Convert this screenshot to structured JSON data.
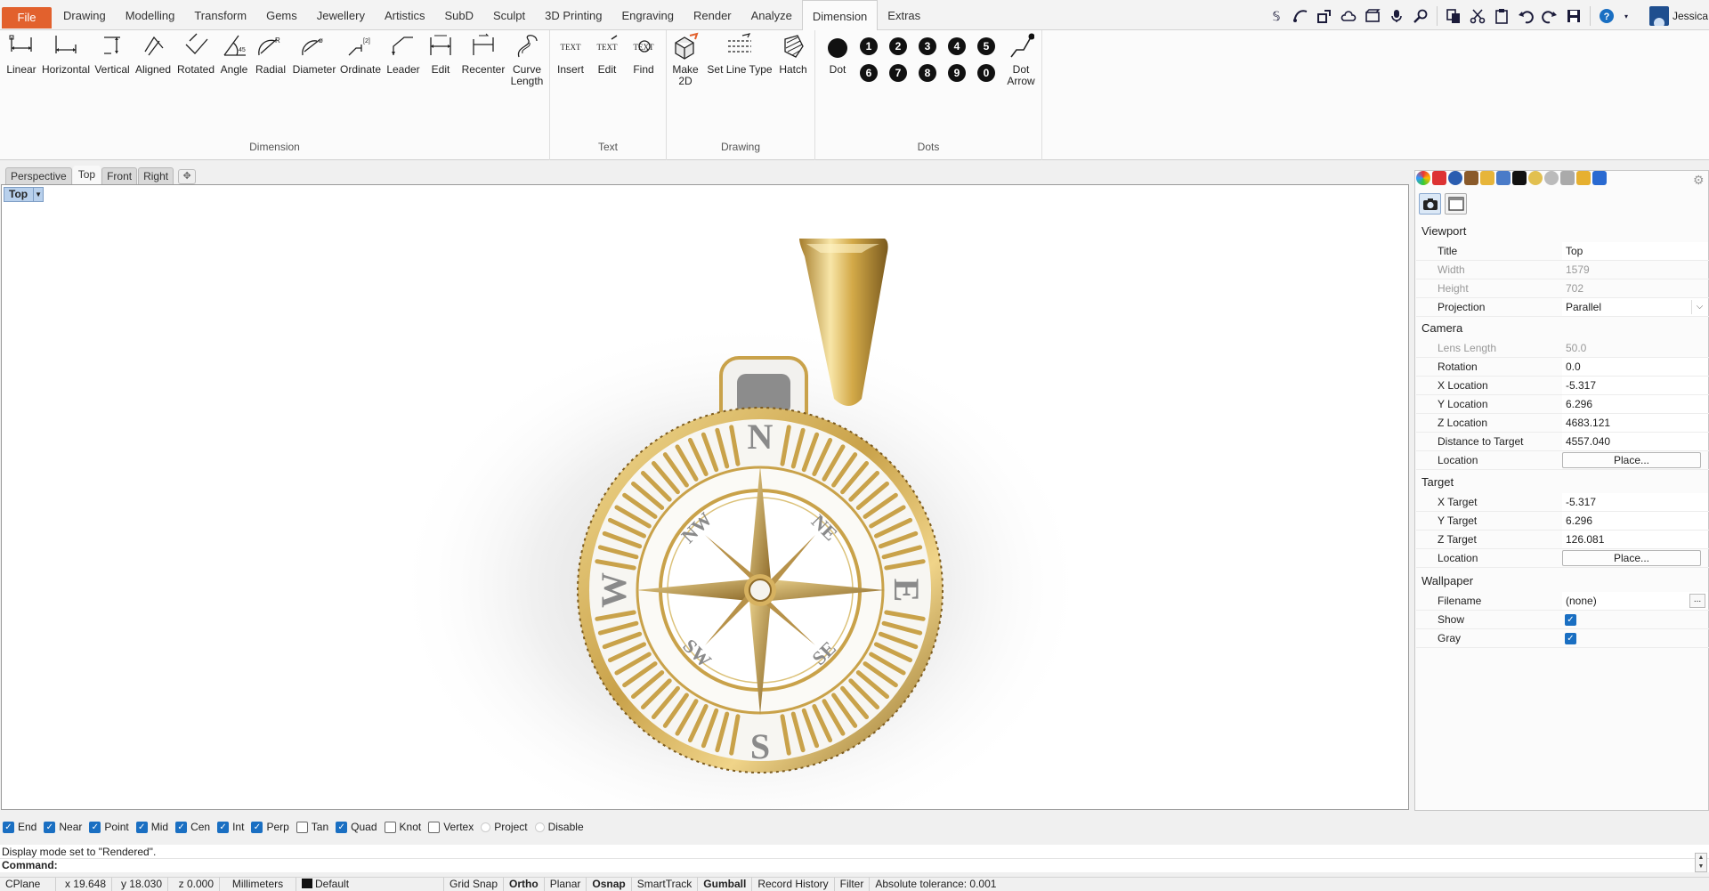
{
  "menubar": {
    "file_label": "File",
    "tabs": [
      "Drawing",
      "Modelling",
      "Transform",
      "Gems",
      "Jewellery",
      "Artistics",
      "SubD",
      "Sculpt",
      "3D Printing",
      "Engraving",
      "Render",
      "Analyze",
      "Dimension",
      "Extras"
    ],
    "active_tab": "Dimension",
    "quick_icons": [
      "script-icon",
      "curve-tool-icon",
      "scale-icon",
      "cloud-icon",
      "video-icon",
      "microphone-icon",
      "zoom-selected-icon",
      "copy-icon",
      "cut-icon",
      "paste-icon",
      "undo-icon",
      "redo-icon",
      "save-icon",
      "help-icon"
    ],
    "user_name": "Jessica"
  },
  "ribbon": {
    "dimension": {
      "label": "Dimension",
      "buttons": [
        {
          "id": "linear",
          "label": "Linear"
        },
        {
          "id": "horizontal",
          "label": "Horizontal"
        },
        {
          "id": "vertical",
          "label": "Vertical"
        },
        {
          "id": "aligned",
          "label": "Aligned"
        },
        {
          "id": "rotated",
          "label": "Rotated"
        },
        {
          "id": "angle",
          "label": "Angle"
        },
        {
          "id": "radial",
          "label": "Radial"
        },
        {
          "id": "diameter",
          "label": "Diameter"
        },
        {
          "id": "ordinate",
          "label": "Ordinate"
        },
        {
          "id": "leader",
          "label": "Leader"
        },
        {
          "id": "edit",
          "label": "Edit"
        },
        {
          "id": "recenter",
          "label": "Recenter"
        },
        {
          "id": "curve-length",
          "label": "Curve\nLength"
        }
      ]
    },
    "text": {
      "label": "Text",
      "buttons": [
        {
          "id": "insert",
          "label": "Insert",
          "glyph": "TEXT"
        },
        {
          "id": "edit",
          "label": "Edit",
          "glyph": "TEXT"
        },
        {
          "id": "find",
          "label": "Find",
          "glyph": "TEXT"
        }
      ]
    },
    "drawing": {
      "label": "Drawing",
      "buttons": [
        {
          "id": "make-2d",
          "label": "Make\n2D"
        },
        {
          "id": "set-line-type",
          "label": "Set Line Type"
        },
        {
          "id": "hatch",
          "label": "Hatch"
        }
      ]
    },
    "dots": {
      "label": "Dots",
      "dot_label": "Dot",
      "numbers_row1": [
        "1",
        "2",
        "3",
        "4",
        "5"
      ],
      "numbers_row2": [
        "6",
        "7",
        "8",
        "9",
        "0"
      ],
      "dot_arrow_label": "Dot\nArrow"
    }
  },
  "viewport_tabs": [
    "Perspective",
    "Top",
    "Front",
    "Right"
  ],
  "viewport": {
    "active_tab": "Top",
    "label": "Top",
    "compass_letters": {
      "n": "N",
      "s": "S",
      "e": "E",
      "w": "W",
      "ne": "NE",
      "nw": "NW",
      "se": "SE",
      "sw": "SW"
    }
  },
  "properties": {
    "viewport_section": "Viewport",
    "title_label": "Title",
    "title_value": "Top",
    "width_label": "Width",
    "width_value": "1579",
    "height_label": "Height",
    "height_value": "702",
    "projection_label": "Projection",
    "projection_value": "Parallel",
    "camera_section": "Camera",
    "lens_label": "Lens Length",
    "lens_value": "50.0",
    "rotation_label": "Rotation",
    "rotation_value": "0.0",
    "xloc_label": "X Location",
    "xloc_value": "-5.317",
    "yloc_label": "Y Location",
    "yloc_value": "6.296",
    "zloc_label": "Z Location",
    "zloc_value": "4683.121",
    "dist_label": "Distance to Target",
    "dist_value": "4557.040",
    "cam_location_label": "Location",
    "place_label": "Place...",
    "target_section": "Target",
    "xt_label": "X Target",
    "xt_value": "-5.317",
    "yt_label": "Y Target",
    "yt_value": "6.296",
    "zt_label": "Z Target",
    "zt_value": "126.081",
    "target_location_label": "Location",
    "wallpaper_section": "Wallpaper",
    "filename_label": "Filename",
    "filename_value": "(none)",
    "ellipsis": "...",
    "show_label": "Show",
    "show_checked": true,
    "gray_label": "Gray",
    "gray_checked": true
  },
  "osnaps": [
    {
      "label": "End",
      "checked": true,
      "kind": "check"
    },
    {
      "label": "Near",
      "checked": true,
      "kind": "check"
    },
    {
      "label": "Point",
      "checked": true,
      "kind": "check"
    },
    {
      "label": "Mid",
      "checked": true,
      "kind": "check"
    },
    {
      "label": "Cen",
      "checked": true,
      "kind": "check"
    },
    {
      "label": "Int",
      "checked": true,
      "kind": "check"
    },
    {
      "label": "Perp",
      "checked": true,
      "kind": "check"
    },
    {
      "label": "Tan",
      "checked": false,
      "kind": "check"
    },
    {
      "label": "Quad",
      "checked": true,
      "kind": "check"
    },
    {
      "label": "Knot",
      "checked": false,
      "kind": "check"
    },
    {
      "label": "Vertex",
      "checked": false,
      "kind": "check"
    },
    {
      "label": "Project",
      "checked": false,
      "kind": "radio"
    },
    {
      "label": "Disable",
      "checked": false,
      "kind": "radio"
    }
  ],
  "command": {
    "history": "Display mode set to \"Rendered\".",
    "prompt": "Command:"
  },
  "status": {
    "cplane": "CPlane",
    "x": "x 19.648",
    "y": "y 18.030",
    "z": "z 0.000",
    "units": "Millimeters",
    "layer": "Default",
    "grid_snap": "Grid Snap",
    "ortho": "Ortho",
    "planar": "Planar",
    "osnap": "Osnap",
    "smarttrack": "SmartTrack",
    "gumball": "Gumball",
    "record_history": "Record History",
    "filter": "Filter",
    "tolerance": "Absolute tolerance: 0.001"
  },
  "colors": {
    "file_tab": "#e2612d",
    "gold": "#c9a24a",
    "accent_blue": "#1a6fc2",
    "viewport_label": "#b8d0ec"
  }
}
